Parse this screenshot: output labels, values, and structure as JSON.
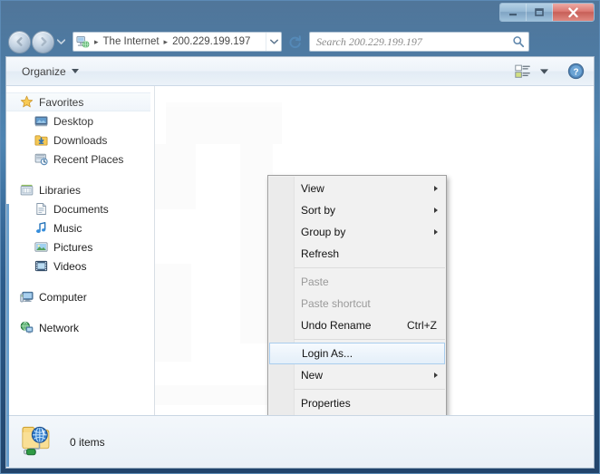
{
  "window": {
    "controls": {
      "minimize_label": "Minimize",
      "maximize_label": "Maximize",
      "close_label": "Close"
    }
  },
  "addressbar": {
    "back_label": "Back",
    "forward_label": "Forward",
    "recent_pages_label": "Recent pages",
    "crumbs": [
      {
        "label": "The Internet"
      },
      {
        "label": "200.229.199.197"
      }
    ],
    "separator": "▸",
    "dropdown_label": "Previous locations",
    "refresh_label": "Refresh"
  },
  "search": {
    "placeholder": "Search 200.229.199.197",
    "value": ""
  },
  "toolbar": {
    "organize_label": "Organize",
    "change_view_label": "Change your view",
    "view_dropdown_label": "More options",
    "help_label": "Help"
  },
  "navpane": {
    "items": [
      {
        "label": "Favorites",
        "icon": "star-icon",
        "level": "top",
        "state": "hover"
      },
      {
        "label": "Desktop",
        "icon": "desktop-icon",
        "level": "child",
        "state": ""
      },
      {
        "label": "Downloads",
        "icon": "downloads-icon",
        "level": "child",
        "state": ""
      },
      {
        "label": "Recent Places",
        "icon": "recent-places-icon",
        "level": "child",
        "state": ""
      },
      {
        "label": "Libraries",
        "icon": "libraries-icon",
        "level": "top",
        "state": ""
      },
      {
        "label": "Documents",
        "icon": "documents-icon",
        "level": "child",
        "state": ""
      },
      {
        "label": "Music",
        "icon": "music-icon",
        "level": "child",
        "state": ""
      },
      {
        "label": "Pictures",
        "icon": "pictures-icon",
        "level": "child",
        "state": ""
      },
      {
        "label": "Videos",
        "icon": "videos-icon",
        "level": "child",
        "state": ""
      },
      {
        "label": "Computer",
        "icon": "computer-icon",
        "level": "top",
        "state": ""
      },
      {
        "label": "Network",
        "icon": "network-icon",
        "level": "top",
        "state": ""
      }
    ]
  },
  "context_menu": {
    "items": [
      {
        "label": "View",
        "accel": "",
        "submenu": true,
        "disabled": false,
        "selected": false,
        "separator_after": false
      },
      {
        "label": "Sort by",
        "accel": "",
        "submenu": true,
        "disabled": false,
        "selected": false,
        "separator_after": false
      },
      {
        "label": "Group by",
        "accel": "",
        "submenu": true,
        "disabled": false,
        "selected": false,
        "separator_after": false
      },
      {
        "label": "Refresh",
        "accel": "",
        "submenu": false,
        "disabled": false,
        "selected": false,
        "separator_after": true
      },
      {
        "label": "Paste",
        "accel": "",
        "submenu": false,
        "disabled": true,
        "selected": false,
        "separator_after": false
      },
      {
        "label": "Paste shortcut",
        "accel": "",
        "submenu": false,
        "disabled": true,
        "selected": false,
        "separator_after": false
      },
      {
        "label": "Undo Rename",
        "accel": "Ctrl+Z",
        "submenu": false,
        "disabled": false,
        "selected": false,
        "separator_after": true
      },
      {
        "label": "Login As...",
        "accel": "",
        "submenu": false,
        "disabled": false,
        "selected": true,
        "separator_after": false
      },
      {
        "label": "New",
        "accel": "",
        "submenu": true,
        "disabled": false,
        "selected": false,
        "separator_after": true
      },
      {
        "label": "Properties",
        "accel": "",
        "submenu": false,
        "disabled": false,
        "selected": false,
        "separator_after": false
      }
    ]
  },
  "statusbar": {
    "item_count_text": "0 items",
    "icon": "ftp-site-icon"
  },
  "colors": {
    "title_bar": "#2d6596",
    "selection_border": "#a9cdee",
    "selection_fill": "#e4eff9",
    "close_button": "#b8352c",
    "nav_accent": "#4f8ec4"
  }
}
